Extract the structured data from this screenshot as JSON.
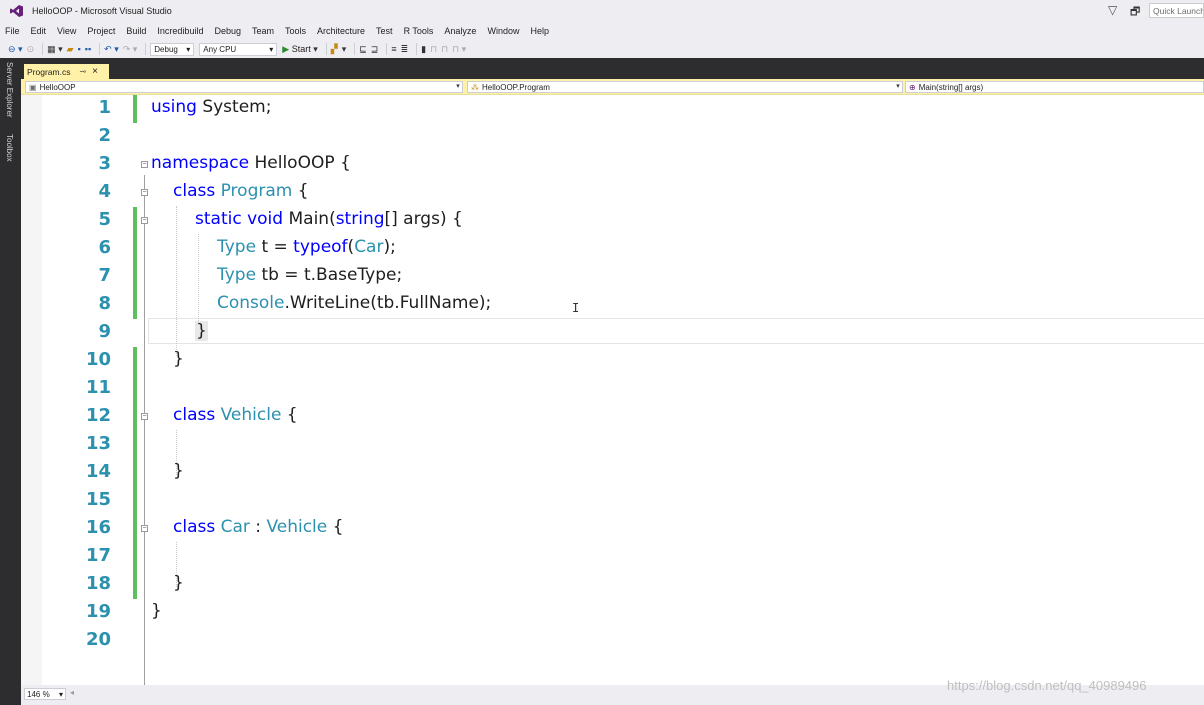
{
  "window": {
    "title": "HelloOOP - Microsoft Visual Studio",
    "quick_launch_placeholder": "Quick Launch"
  },
  "menu": [
    "File",
    "Edit",
    "View",
    "Project",
    "Build",
    "Incredibuild",
    "Debug",
    "Team",
    "Tools",
    "Architecture",
    "Test",
    "R Tools",
    "Analyze",
    "Window",
    "Help"
  ],
  "toolbar": {
    "config": "Debug",
    "platform": "Any CPU",
    "start_label": "Start"
  },
  "side_tabs": {
    "server_explorer": "Server Explorer",
    "toolbox": "Toolbox"
  },
  "tab": {
    "file_name": "Program.cs"
  },
  "navbar": {
    "project": "HelloOOP",
    "class": "HelloOOP.Program",
    "member": "Main(string[] args)"
  },
  "editor": {
    "line_numbers": [
      "1",
      "2",
      "3",
      "4",
      "5",
      "6",
      "7",
      "8",
      "9",
      "10",
      "11",
      "12",
      "13",
      "14",
      "15",
      "16",
      "17",
      "18",
      "19",
      "20"
    ],
    "tokens": {
      "l1_kw": "using",
      "l1_rest": " System;",
      "l3_kw": "namespace",
      "l3_rest": " HelloOOP {",
      "l4_kw": "class",
      "l4_ty": "Program",
      "l4_rest": " {",
      "l5_kw1": "static",
      "l5_kw2": "void",
      "l5_mid": " Main(",
      "l5_kw3": "string",
      "l5_rest": "[] args) {",
      "l6_ty": "Type",
      "l6_mid": " t = ",
      "l6_kw": "typeof",
      "l6_p1": "(",
      "l6_ty2": "Car",
      "l6_p2": ");",
      "l7_ty": "Type",
      "l7_rest": " tb = t.BaseType;",
      "l8_ty": "Console",
      "l8_rest": ".WriteLine(tb.FullName);",
      "l9": "}",
      "l10": "}",
      "l12_kw": "class",
      "l12_ty": "Vehicle",
      "l12_rest": " {",
      "l14": "}",
      "l16_kw": "class",
      "l16_ty": "Car",
      "l16_mid": " : ",
      "l16_ty2": "Vehicle",
      "l16_rest": " {",
      "l18": "}",
      "l19": "}"
    }
  },
  "status": {
    "zoom": "146 %"
  },
  "watermark": "https://blog.csdn.net/qq_40989496",
  "colors": {
    "keyword": "#0000ff",
    "type": "#2b91af",
    "line_number": "#2b91af",
    "change_marker": "#5fbf5f",
    "active_tab": "#fff1a8",
    "frame_dark": "#2d2d30"
  }
}
